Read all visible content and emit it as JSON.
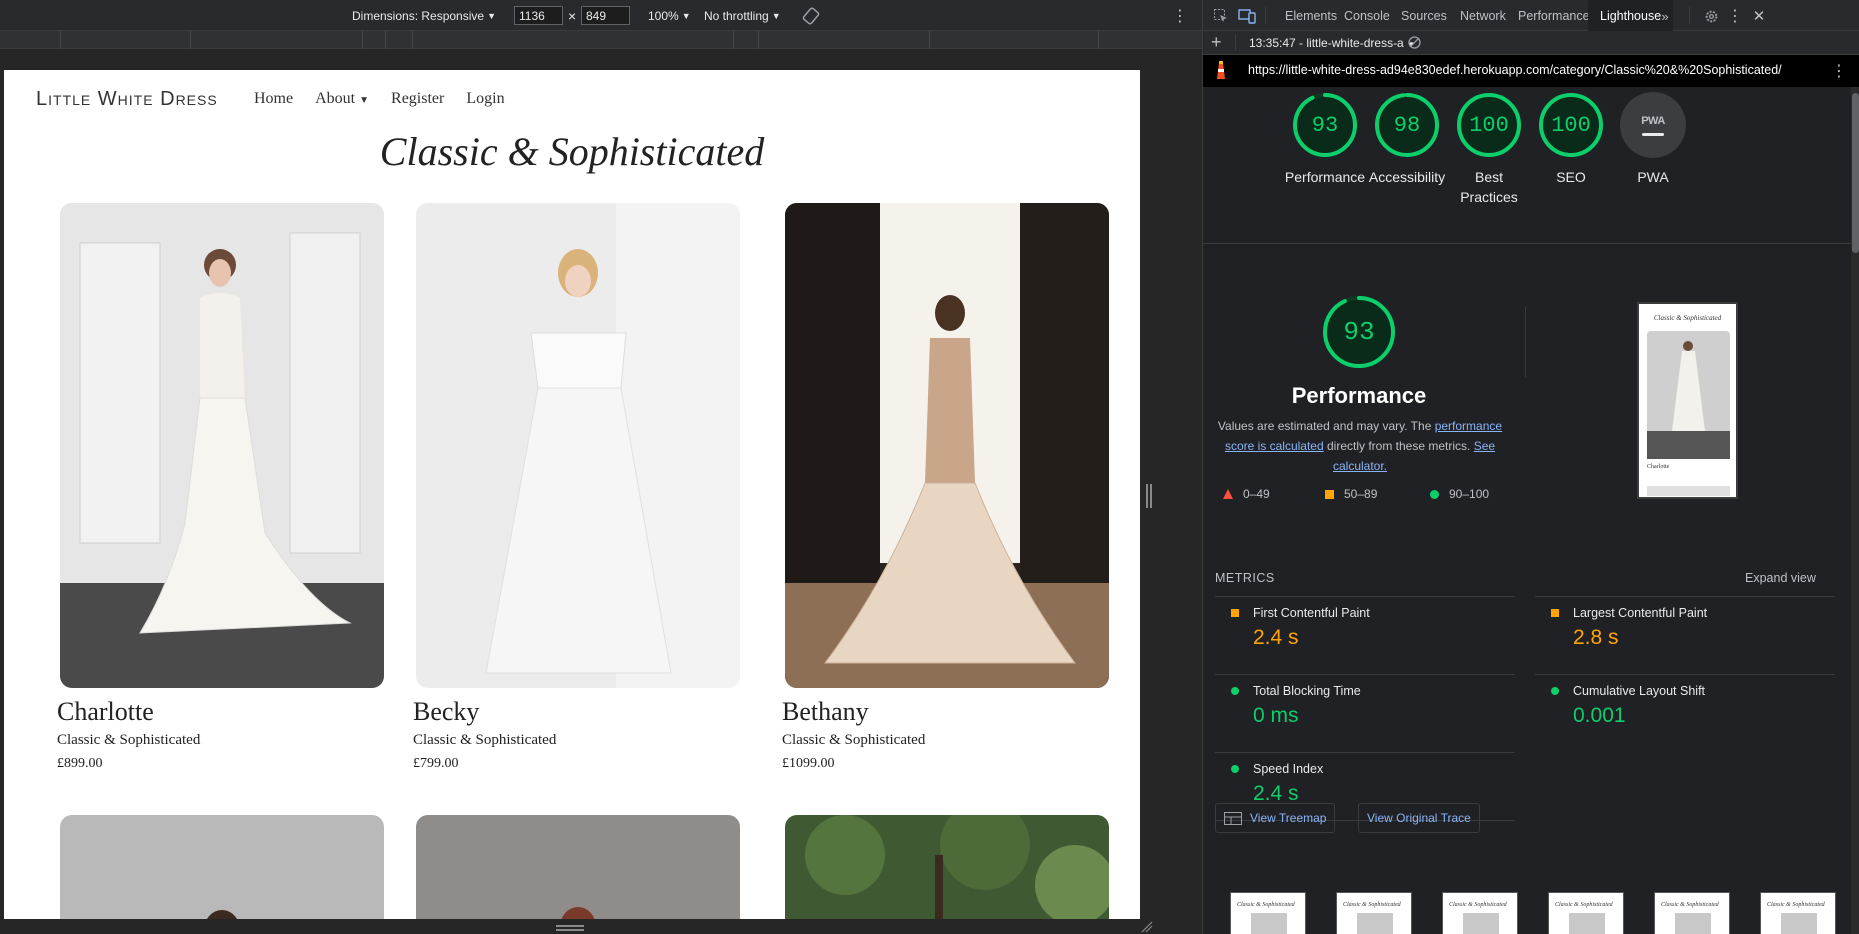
{
  "device_toolbar": {
    "dimensions_label": "Dimensions: Responsive",
    "width": "1136",
    "times": "×",
    "height": "849",
    "zoom": "100%",
    "throttling": "No throttling"
  },
  "site": {
    "brand": "Little White Dress",
    "nav": [
      "Home",
      "About",
      "Register",
      "Login"
    ],
    "page_title": "Classic & Sophisticated",
    "products": [
      {
        "name": "Charlotte",
        "category": "Classic & Sophisticated",
        "price": "£899.00"
      },
      {
        "name": "Becky",
        "category": "Classic & Sophisticated",
        "price": "£799.00"
      },
      {
        "name": "Bethany",
        "category": "Classic & Sophisticated",
        "price": "£1099.00"
      }
    ]
  },
  "devtools": {
    "tabs": [
      "Elements",
      "Console",
      "Sources",
      "Network",
      "Performance",
      "Lighthouse"
    ],
    "active_tab": "Lighthouse",
    "report_selector": "13:35:47 - little-white-dress-a",
    "url": "https://little-white-dress-ad94e830edef.herokuapp.com/category/Classic%20&%20Sophisticated/"
  },
  "lighthouse": {
    "scores": [
      {
        "label": "Performance",
        "value": "93"
      },
      {
        "label": "Accessibility",
        "value": "98"
      },
      {
        "label": "Best Practices",
        "value": "100"
      },
      {
        "label": "SEO",
        "value": "100"
      },
      {
        "label": "PWA",
        "value": ""
      }
    ],
    "pwa_badge": "PWA",
    "performance": {
      "score": "93",
      "title": "Performance",
      "desc_prefix": "Values are estimated and may vary. The ",
      "desc_link1": "performance score is calculated",
      "desc_mid": " directly from these metrics. ",
      "desc_link2": "See calculator."
    },
    "legend": {
      "fail": "0–49",
      "average": "50–89",
      "pass": "90–100"
    },
    "thumbnail": {
      "title": "Classic & Sophisticated",
      "name": "Charlotte"
    },
    "metrics_header": "METRICS",
    "expand_view": "Expand view",
    "metrics": [
      {
        "label": "First Contentful Paint",
        "value": "2.4 s",
        "status": "average"
      },
      {
        "label": "Largest Contentful Paint",
        "value": "2.8 s",
        "status": "average"
      },
      {
        "label": "Total Blocking Time",
        "value": "0 ms",
        "status": "pass"
      },
      {
        "label": "Cumulative Layout Shift",
        "value": "0.001",
        "status": "pass"
      },
      {
        "label": "Speed Index",
        "value": "2.4 s",
        "status": "pass"
      }
    ],
    "buttons": {
      "treemap": "View Treemap",
      "trace": "View Original Trace"
    },
    "filmstrip_title": "Classic & Sophisticated"
  },
  "colors": {
    "pass": "#0cce6b",
    "average": "#ffa400",
    "fail": "#ff4e42",
    "link": "#8ab4f8",
    "devtools_bg": "#202124"
  },
  "icons": [
    "inspect-icon",
    "device-toggle-icon",
    "rotate-icon",
    "more-vert-icon",
    "more-tabs-icon",
    "settings-icon",
    "close-icon",
    "plus-icon",
    "clear-icon",
    "lighthouse-logo-icon",
    "treemap-icon"
  ]
}
